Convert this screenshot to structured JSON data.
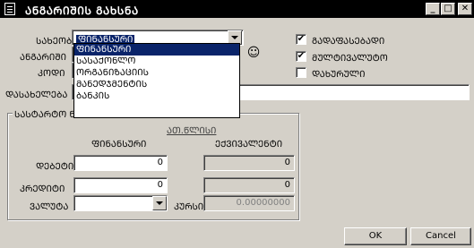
{
  "window": {
    "title": "ᲐᲜᲒᲐᲠᲘᲨᲘᲡ ᲒᲐᲮᲡᲜᲐ",
    "minimize": "_",
    "maximize": "□",
    "close": "✕"
  },
  "form": {
    "type_label": "ᲡᲐᲮᲔᲝᲑᲐ",
    "type_value": "ᲤᲘᲜᲐᲜᲡᲣᲠᲘ",
    "account_label": "ᲐᲜᲒᲐᲠᲘᲨᲘ",
    "code_label": "ᲙᲝᲓᲘ",
    "name_label": "ᲓᲐᲡᲐᲮᲔᲚᲔᲑᲐ",
    "name_value": ""
  },
  "dropdown": {
    "items": [
      "ᲤᲘᲜᲐᲜᲡᲣᲠᲘ",
      "ᲡᲐᲡᲐᲥᲝᲜᲚᲝ",
      "ᲝᲠᲒᲐᲜᲘᲖᲐᲪᲘᲘᲡ",
      "ᲛᲐᲜᲔᲓᲯᲛᲔᲜᲢᲘᲡ",
      "ᲑᲐᲜᲙᲘᲡ"
    ]
  },
  "checkboxes": [
    {
      "label": "ᲒᲐᲓᲐᲤᲐᲡᲔᲑᲐᲓᲘ",
      "checked": "✔"
    },
    {
      "label": "ᲛᲣᲚᲢᲘᲕᲐᲚᲣᲢᲝ",
      "checked": "✔"
    },
    {
      "label": "ᲓᲐᲮᲣᲠᲣᲚᲘ",
      "checked": ""
    }
  ],
  "balance": {
    "group_title": "ᲡᲐᲡᲢᲐᲠᲢᲝ ᲜᲐᲨᲗᲔᲑᲘ",
    "tab_label": "ᲐᲗ.ᲬᲚᲘᲡᲘ",
    "col_financial": "ᲤᲘᲜᲐᲜᲡᲣᲠᲘ",
    "col_equivalent": "ᲔᲥᲕᲘᲕᲐᲚᲔᲜᲢᲘ",
    "debit_label": "ᲓᲔᲑᲔᲢᲘ",
    "debit_value": "0",
    "debit_equiv": "0",
    "credit_label": "ᲙᲠᲔᲓᲘᲢᲘ",
    "credit_value": "0",
    "credit_equiv": "0",
    "currency_label": "ᲕᲐᲚᲣᲢᲐ",
    "currency_value": "",
    "rate_label": "ᲙᲣᲠᲡᲘ",
    "rate_value": "0.00000000"
  },
  "buttons": {
    "ok": "OK",
    "cancel": "Cancel"
  },
  "colors": {
    "selection": "#0a246a",
    "face": "#d4d0c8"
  }
}
